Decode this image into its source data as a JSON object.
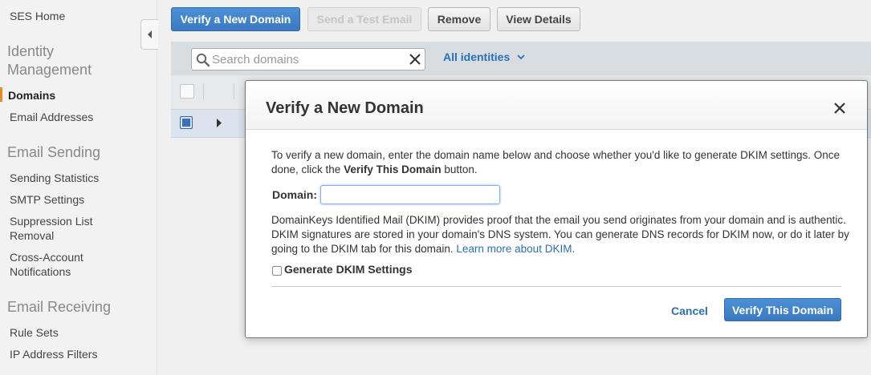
{
  "sidebar": {
    "home": "SES Home",
    "sections": [
      {
        "heading": "Identity Management",
        "items": [
          "Domains",
          "Email Addresses"
        ]
      },
      {
        "heading": "Email Sending",
        "items": [
          "Sending Statistics",
          "SMTP Settings",
          "Suppression List Removal",
          "Cross-Account Notifications"
        ]
      },
      {
        "heading": "Email Receiving",
        "items": [
          "Rule Sets",
          "IP Address Filters"
        ]
      }
    ],
    "active_item": "Domains"
  },
  "toolbar": {
    "verify_domain": "Verify a New Domain",
    "send_test": "Send a Test Email",
    "remove": "Remove",
    "view_details": "View Details"
  },
  "filter": {
    "search_placeholder": "Search domains",
    "search_value": "",
    "identities": "All identities"
  },
  "modal": {
    "title": "Verify a New Domain",
    "intro_start": "To verify a new domain, enter the domain name below and choose whether you'd like to generate DKIM settings. Once done, click the ",
    "intro_bold": "Verify This Domain",
    "intro_end": " button.",
    "domain_label": "Domain:",
    "domain_value": "",
    "dkim_text": "DomainKeys Identified Mail (DKIM) provides proof that the email you send originates from your domain and is authentic. DKIM signatures are stored in your domain's DNS system. You can generate DNS records for DKIM now, or do it later by going to the DKIM tab for this domain. ",
    "dkim_link": "Learn more about DKIM.",
    "dkim_checkbox_label": "Generate DKIM Settings",
    "dkim_checked": false,
    "cancel": "Cancel",
    "verify": "Verify This Domain"
  },
  "colors": {
    "primary": "#3f82cc",
    "link": "#2a6fb7",
    "active_marker": "#e98b1f"
  }
}
